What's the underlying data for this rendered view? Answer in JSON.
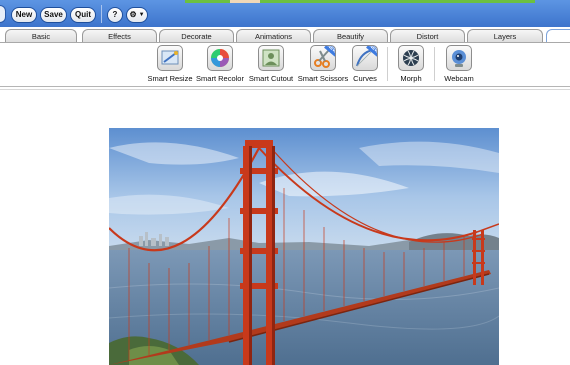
{
  "toolbar": {
    "new_label": "New",
    "save_label": "Save",
    "quit_label": "Quit",
    "help_label": "?"
  },
  "tabs": [
    {
      "label": "Basic"
    },
    {
      "label": "Effects"
    },
    {
      "label": "Decorate"
    },
    {
      "label": "Animations"
    },
    {
      "label": "Beautify"
    },
    {
      "label": "Distort"
    },
    {
      "label": "Layers"
    },
    {
      "label": ""
    }
  ],
  "tools": [
    {
      "label": "Smart Resize",
      "icon": "smart-resize-icon"
    },
    {
      "label": "Smart Recolor",
      "icon": "smart-recolor-icon"
    },
    {
      "label": "Smart Cutout",
      "icon": "smart-cutout-icon"
    },
    {
      "label": "Smart Scissors",
      "icon": "smart-scissors-icon",
      "badge": "NEW"
    },
    {
      "label": "Curves",
      "icon": "curves-icon",
      "badge": "NEW"
    },
    {
      "label": "Morph",
      "icon": "morph-icon"
    },
    {
      "label": "Webcam",
      "icon": "webcam-icon"
    }
  ],
  "canvas": {
    "image": "golden-gate-bridge-photo"
  },
  "colors": {
    "toolbar": "#4a82d8",
    "bridge": "#c8391b",
    "sky": "#8db4e0",
    "water": "#5f7f9f"
  }
}
